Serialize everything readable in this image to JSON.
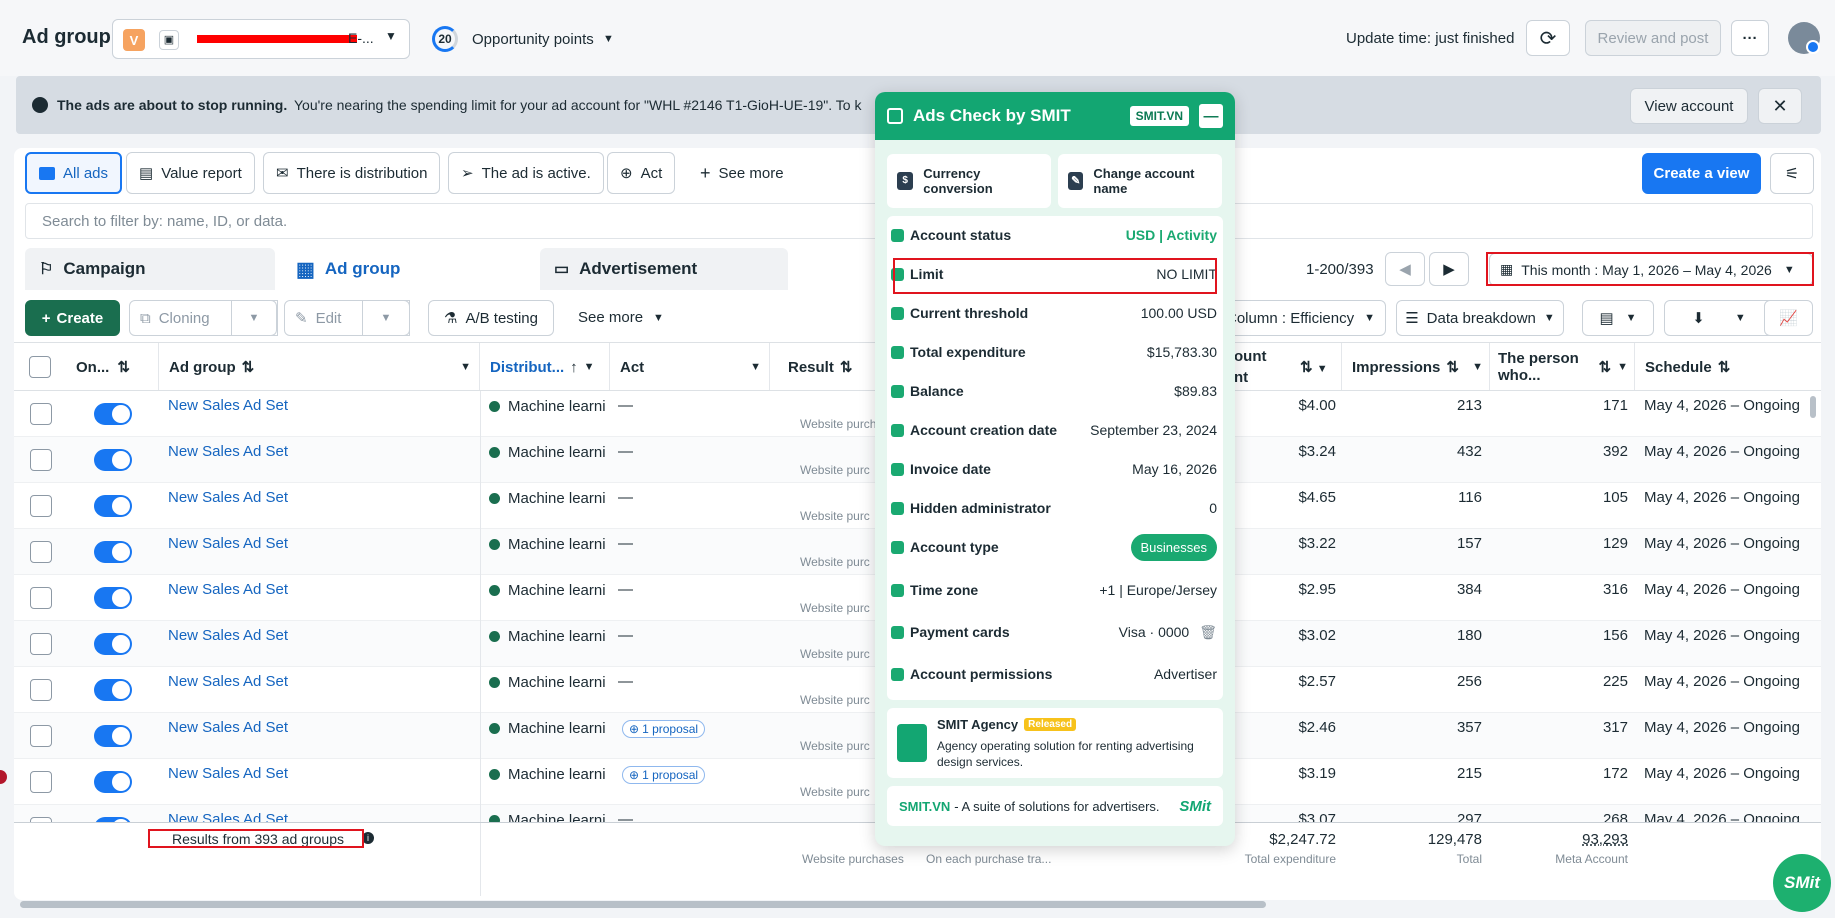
{
  "header": {
    "title": "Ad group",
    "account_initial": "V",
    "account_name_suffix": "E-...",
    "opportunity_score": "20",
    "opportunity_label": "Opportunity points",
    "update_time": "Update time: just finished",
    "review_post": "Review and post",
    "more": "···"
  },
  "banner": {
    "title": "The ads are about to stop running.",
    "message": "You're nearing the spending limit for your ad account for \"WHL #2146 T1-GioH-UE-19\". To k",
    "view_account": "View account",
    "close": "✕"
  },
  "filters": {
    "items": [
      "All ads",
      "Value report",
      "There is distribution",
      "The ad is active.",
      "Act"
    ],
    "see_more": "See more",
    "create_view": "Create a view",
    "search_placeholder": "Search to filter by: name, ID, or data."
  },
  "tabs": {
    "campaign": "Campaign",
    "ad_group": "Ad group",
    "advertisement": "Advertisement",
    "pagination": "1-200/393",
    "date_range": "This month : May 1, 2026 – May 4, 2026"
  },
  "toolbar": {
    "create": "Create",
    "cloning": "Cloning",
    "edit": "Edit",
    "ab_testing": "A/B testing",
    "see_more": "See more",
    "column": "Column : Efficiency",
    "breakdown": "Data breakdown"
  },
  "columns": {
    "on": "On...",
    "ad_group": "Ad group",
    "distribution": "Distribut...",
    "act": "Act",
    "result": "Result",
    "amount_a": "ount",
    "amount_b": "nt",
    "impressions": "Impressions",
    "person_a": "The person",
    "person_b": "who...",
    "schedule": "Schedule"
  },
  "rows": [
    {
      "name": "New Sales Ad Set",
      "dist": "Machine learni",
      "act": "—",
      "result_sub": "Website purch",
      "amount": "$4.00",
      "impressions": "213",
      "people": "171",
      "schedule": "May 4, 2026 – Ongoing"
    },
    {
      "name": "New Sales Ad Set",
      "dist": "Machine learni",
      "act": "—",
      "result_sub": "Website purc",
      "amount": "$3.24",
      "impressions": "432",
      "people": "392",
      "schedule": "May 4, 2026 – Ongoing"
    },
    {
      "name": "New Sales Ad Set",
      "dist": "Machine learni",
      "act": "—",
      "result_sub": "Website purc",
      "amount": "$4.65",
      "impressions": "116",
      "people": "105",
      "schedule": "May 4, 2026 – Ongoing"
    },
    {
      "name": "New Sales Ad Set",
      "dist": "Machine learni",
      "act": "—",
      "result_sub": "Website purc",
      "amount": "$3.22",
      "impressions": "157",
      "people": "129",
      "schedule": "May 4, 2026 – Ongoing"
    },
    {
      "name": "New Sales Ad Set",
      "dist": "Machine learni",
      "act": "—",
      "result_sub": "Website purc",
      "amount": "$2.95",
      "impressions": "384",
      "people": "316",
      "schedule": "May 4, 2026 – Ongoing"
    },
    {
      "name": "New Sales Ad Set",
      "dist": "Machine learni",
      "act": "—",
      "result_sub": "Website purc",
      "amount": "$3.02",
      "impressions": "180",
      "people": "156",
      "schedule": "May 4, 2026 – Ongoing"
    },
    {
      "name": "New Sales Ad Set",
      "dist": "Machine learni",
      "act": "—",
      "result_sub": "Website purc",
      "amount": "$2.57",
      "impressions": "256",
      "people": "225",
      "schedule": "May 4, 2026 – Ongoing"
    },
    {
      "name": "New Sales Ad Set",
      "dist": "Machine learni",
      "act": "1 proposal",
      "result_sub": "Website purc",
      "amount": "$2.46",
      "impressions": "357",
      "people": "317",
      "schedule": "May 4, 2026 – Ongoing"
    },
    {
      "name": "New Sales Ad Set",
      "dist": "Machine learni",
      "act": "1 proposal",
      "result_sub": "Website purc",
      "amount": "$3.19",
      "impressions": "215",
      "people": "172",
      "schedule": "May 4, 2026 – Ongoing"
    },
    {
      "name": "New Sales Ad Set",
      "dist": "Machine learni",
      "act": "—",
      "result_sub": "",
      "amount": "$3.07",
      "impressions": "297",
      "people": "268",
      "schedule": "May 4, 2026 – Ongoing"
    }
  ],
  "footer": {
    "results": "Results from 393 ad groups",
    "result_sub": "Website purchases",
    "cost_sub": "On each purchase tra...",
    "total_amount": "$2,247.72",
    "total_amount_sub": "Total expenditure",
    "total_impressions": "129,478",
    "total_impressions_sub": "Total",
    "total_people": "93,293",
    "total_people_sub": "Meta Account"
  },
  "panel": {
    "title": "Ads Check by SMIT",
    "badge": "SMIT.VN",
    "minimize": "—",
    "btn_currency": "Currency conversion",
    "btn_rename": "Change account name",
    "rows": [
      {
        "label": "Account status",
        "value": "USD | Activity"
      },
      {
        "label": "Limit",
        "value": "NO LIMIT"
      },
      {
        "label": "Current threshold",
        "value": "100.00 USD"
      },
      {
        "label": "Total expenditure",
        "value": "$15,783.30"
      },
      {
        "label": "Balance",
        "value": "$89.83"
      },
      {
        "label": "Account creation date",
        "value": "September 23, 2024"
      },
      {
        "label": "Invoice date",
        "value": "May 16, 2026"
      },
      {
        "label": "Hidden administrator",
        "value": "0"
      },
      {
        "label": "Account type",
        "value": "Businesses"
      },
      {
        "label": "Time zone",
        "value": "+1 | Europe/Jersey"
      },
      {
        "label": "Payment cards",
        "value": "Visa · 0000"
      },
      {
        "label": "Account permissions",
        "value": "Advertiser"
      }
    ],
    "agency_title": "SMIT Agency",
    "agency_badge": "Released",
    "agency_desc": "Agency operating solution for renting advertising design services.",
    "footer_brand": "SMIT.VN",
    "footer_text": "- A suite of solutions for advertisers.",
    "footer_logo": "SMit"
  },
  "fab": "SMit",
  "colors": {
    "blue": "#1877f2",
    "green": "#1aa971",
    "dark_green": "#0b5d3b",
    "red": "#e0141e"
  }
}
